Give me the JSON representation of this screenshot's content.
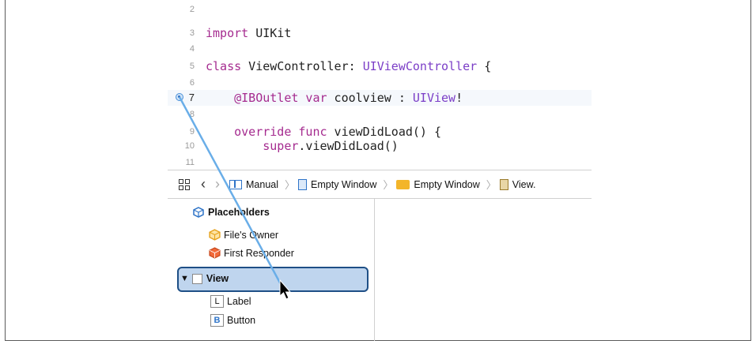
{
  "editor": {
    "lines": [
      {
        "no": "2",
        "text": ""
      },
      {
        "no": "3",
        "kw": "import",
        "rest": " UIKit"
      },
      {
        "no": "4",
        "text": ""
      },
      {
        "no": "5",
        "kw": "class",
        "mid": " ViewController: ",
        "type": "UIViewController",
        "rest": " {"
      },
      {
        "no": "6",
        "text": ""
      },
      {
        "no": "7",
        "kw": "    @IBOutlet var",
        "mid": " coolview : ",
        "type": "UIView",
        "rest": "!"
      },
      {
        "no": "8",
        "text": ""
      },
      {
        "no": "9",
        "kw": "    override func",
        "rest": " viewDidLoad() {"
      },
      {
        "no": "10",
        "kw": "        super",
        "rest": ".viewDidLoad()"
      },
      {
        "no": "11",
        "text": ""
      }
    ]
  },
  "pathbar": {
    "items": [
      "Manual",
      "Empty Window",
      "Empty Window",
      "View."
    ]
  },
  "outline": {
    "placeholders_label": "Placeholders",
    "files_owner": "File's Owner",
    "first_responder": "First Responder",
    "view": "View",
    "label": "Label",
    "button": "Button",
    "label_glyph": "L",
    "button_glyph": "B"
  },
  "colors": {
    "keyword": "#a52b8f",
    "type": "#7b3ec7",
    "selection": "#bfd5ee",
    "connection_line": "#6aaee8"
  }
}
